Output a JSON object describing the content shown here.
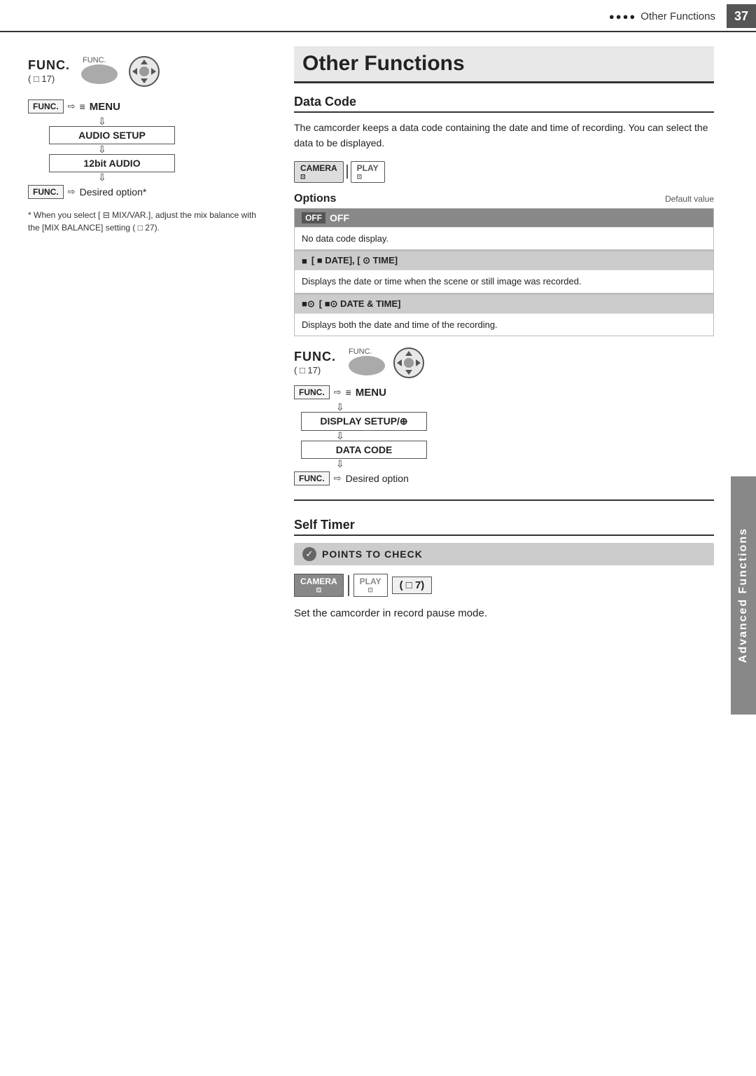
{
  "header": {
    "dots": "●●●●",
    "title": "Other Functions",
    "page_number": "37"
  },
  "side_label": "Advanced Functions",
  "left_col": {
    "func_title": "FUNC.",
    "func_ref": "( □ 17)",
    "func_label_small": "FUNC.",
    "menu_flow": {
      "func_key": "FUNC.",
      "arrow": "⇨",
      "menu_icon": "≡",
      "menu_label": "MENU",
      "step1": "AUDIO  SETUP",
      "step2": "12bit AUDIO",
      "step3": "Desired option*"
    },
    "footnote": "* When you select [ ⊟ MIX/VAR.], adjust the mix balance with the [MIX BALANCE] setting ( □ 27)."
  },
  "right_col": {
    "page_title": "Other Functions",
    "section1": {
      "title": "Data Code",
      "body": "The camcorder keeps a data code containing the date and time of recording. You can select the data to be displayed."
    },
    "mode_badges": {
      "camera": "CAMERA",
      "play": "PLAY"
    },
    "options": {
      "label": "Options",
      "default_label": "Default value",
      "rows": [
        {
          "header": "[ OFF  OFF]",
          "body": "No data code display."
        },
        {
          "subheader": "[ ■ DATE], [ ⊙  TIME]",
          "body": "Displays the date or time when the scene or still image was recorded."
        },
        {
          "subheader": "[ ■⊙  DATE & TIME]",
          "body": "Displays both the date and time of the recording."
        }
      ]
    },
    "func2": {
      "func_title": "FUNC.",
      "func_ref": "( □ 17)",
      "func_label_small": "FUNC.",
      "menu_flow": {
        "func_key": "FUNC.",
        "arrow": "⇨",
        "menu_icon": "≡",
        "menu_label": "MENU",
        "step1": "DISPLAY SETUP/⊕",
        "step2": "DATA CODE",
        "step3": "Desired option"
      }
    },
    "section2": {
      "title": "Self Timer",
      "points_label": "POINTS TO CHECK",
      "camera_badge": "CAMERA",
      "play_badge": "PLAY",
      "ref": "( □ 7)",
      "body": "Set the camcorder in record pause mode."
    }
  }
}
